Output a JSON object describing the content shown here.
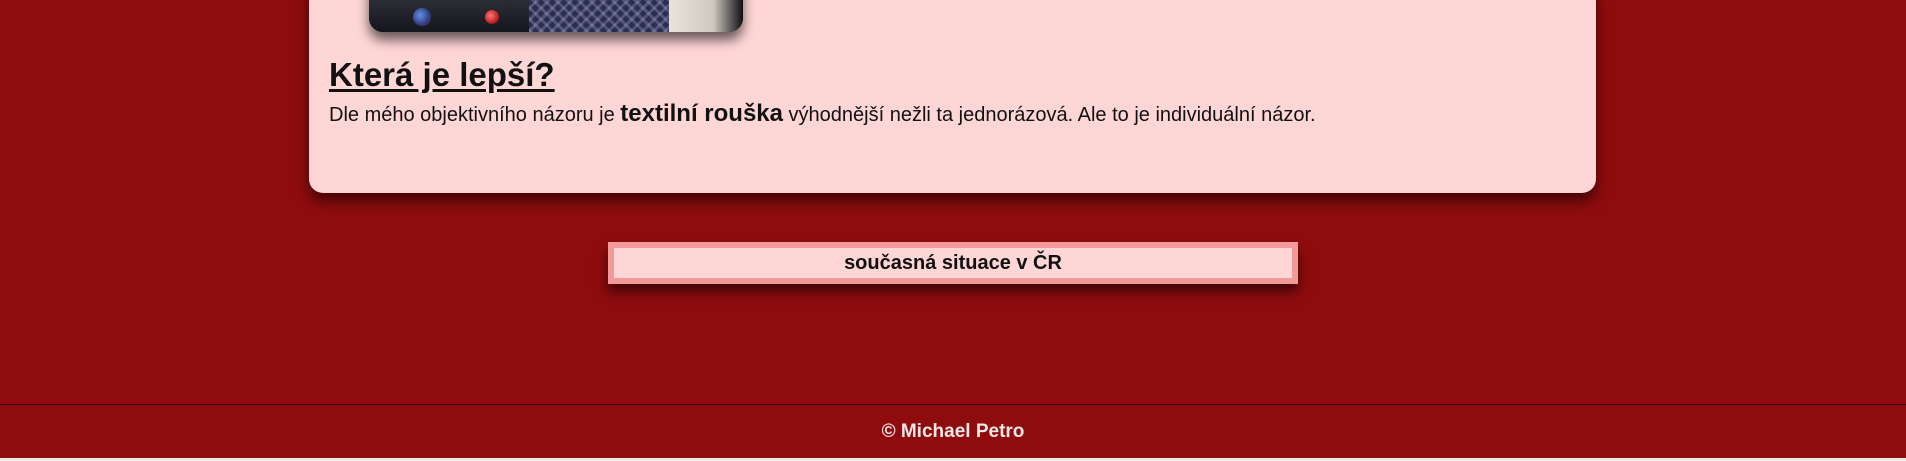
{
  "article": {
    "heading": "Která je lepší?",
    "paragraph": {
      "before": "Dle mého objektivního názoru je ",
      "emphasis": "textilní rouška",
      "after": " výhodnější nežli ta jednorázová. Ale to je individuální názor."
    }
  },
  "nav": {
    "situation_label": "současná situace v ČR"
  },
  "footer": {
    "copyright": "© Michael Petro"
  },
  "colors": {
    "background": "#8f0c0e",
    "card": "#ffd6d6",
    "button_border": "#f29a9a"
  }
}
